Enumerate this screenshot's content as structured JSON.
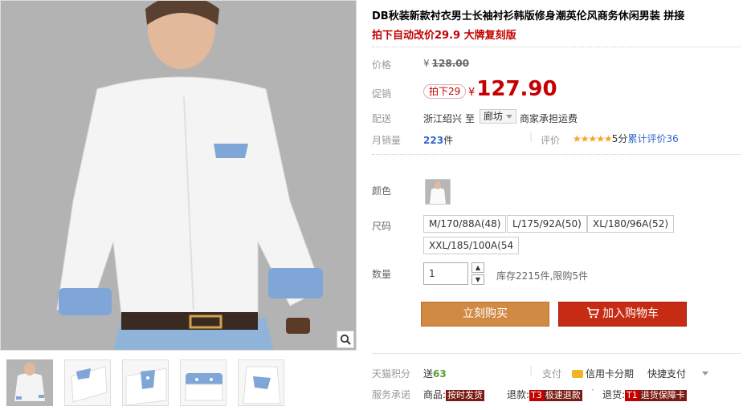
{
  "product": {
    "title": "DB秋装新款衬衣男士长袖衬衫韩版修身潮英伦风商务休闲男装 拼接",
    "subtitle": "拍下自动改价29.9 大牌复刻版"
  },
  "price": {
    "label": "价格",
    "old_currency": "¥",
    "old_value": "128.00",
    "promo_label": "促销",
    "promo_badge": "拍下29",
    "new_currency": "¥",
    "new_value": "127.90"
  },
  "shipping": {
    "label": "配送",
    "from": "浙江绍兴",
    "to_word": "至",
    "city": "廊坊",
    "fee_note": "商家承担运费"
  },
  "sales": {
    "label": "月销量",
    "count": "223",
    "unit": "件",
    "rating_label": "评价",
    "stars": "★★★★★",
    "score_text": "5分",
    "rating_link": "累计评价36"
  },
  "options": {
    "color_label": "颜色",
    "size_label": "尺码",
    "sizes": [
      "M/170/88A(48)",
      "L/175/92A(50)",
      "XL/180/96A(52)",
      "XXL/185/100A(54"
    ]
  },
  "quantity": {
    "label": "数量",
    "value": "1",
    "up": "▲",
    "down": "▼",
    "stock": "库存2215件,限购5件"
  },
  "buttons": {
    "buy": "立刻购买",
    "cart": "加入购物车"
  },
  "points": {
    "label": "天猫积分",
    "give": "送",
    "amount": "63",
    "pay_label": "支付",
    "card_installment": "信用卡分期",
    "quick_pay": "快捷支付"
  },
  "service": {
    "label": "服务承诺",
    "goods_prefix": "商品:",
    "goods_tag": "按时发货",
    "refund_prefix": "退款:",
    "refund_code": "T3",
    "refund_tag": "极速退款",
    "return_prefix": "退货:",
    "return_code": "T1",
    "return_tag": "退货保障卡"
  },
  "colors": {
    "accent_red": "#c40000",
    "buy_orange": "#d08a43",
    "cart_red": "#c62c14",
    "link_blue": "#3366cc"
  }
}
